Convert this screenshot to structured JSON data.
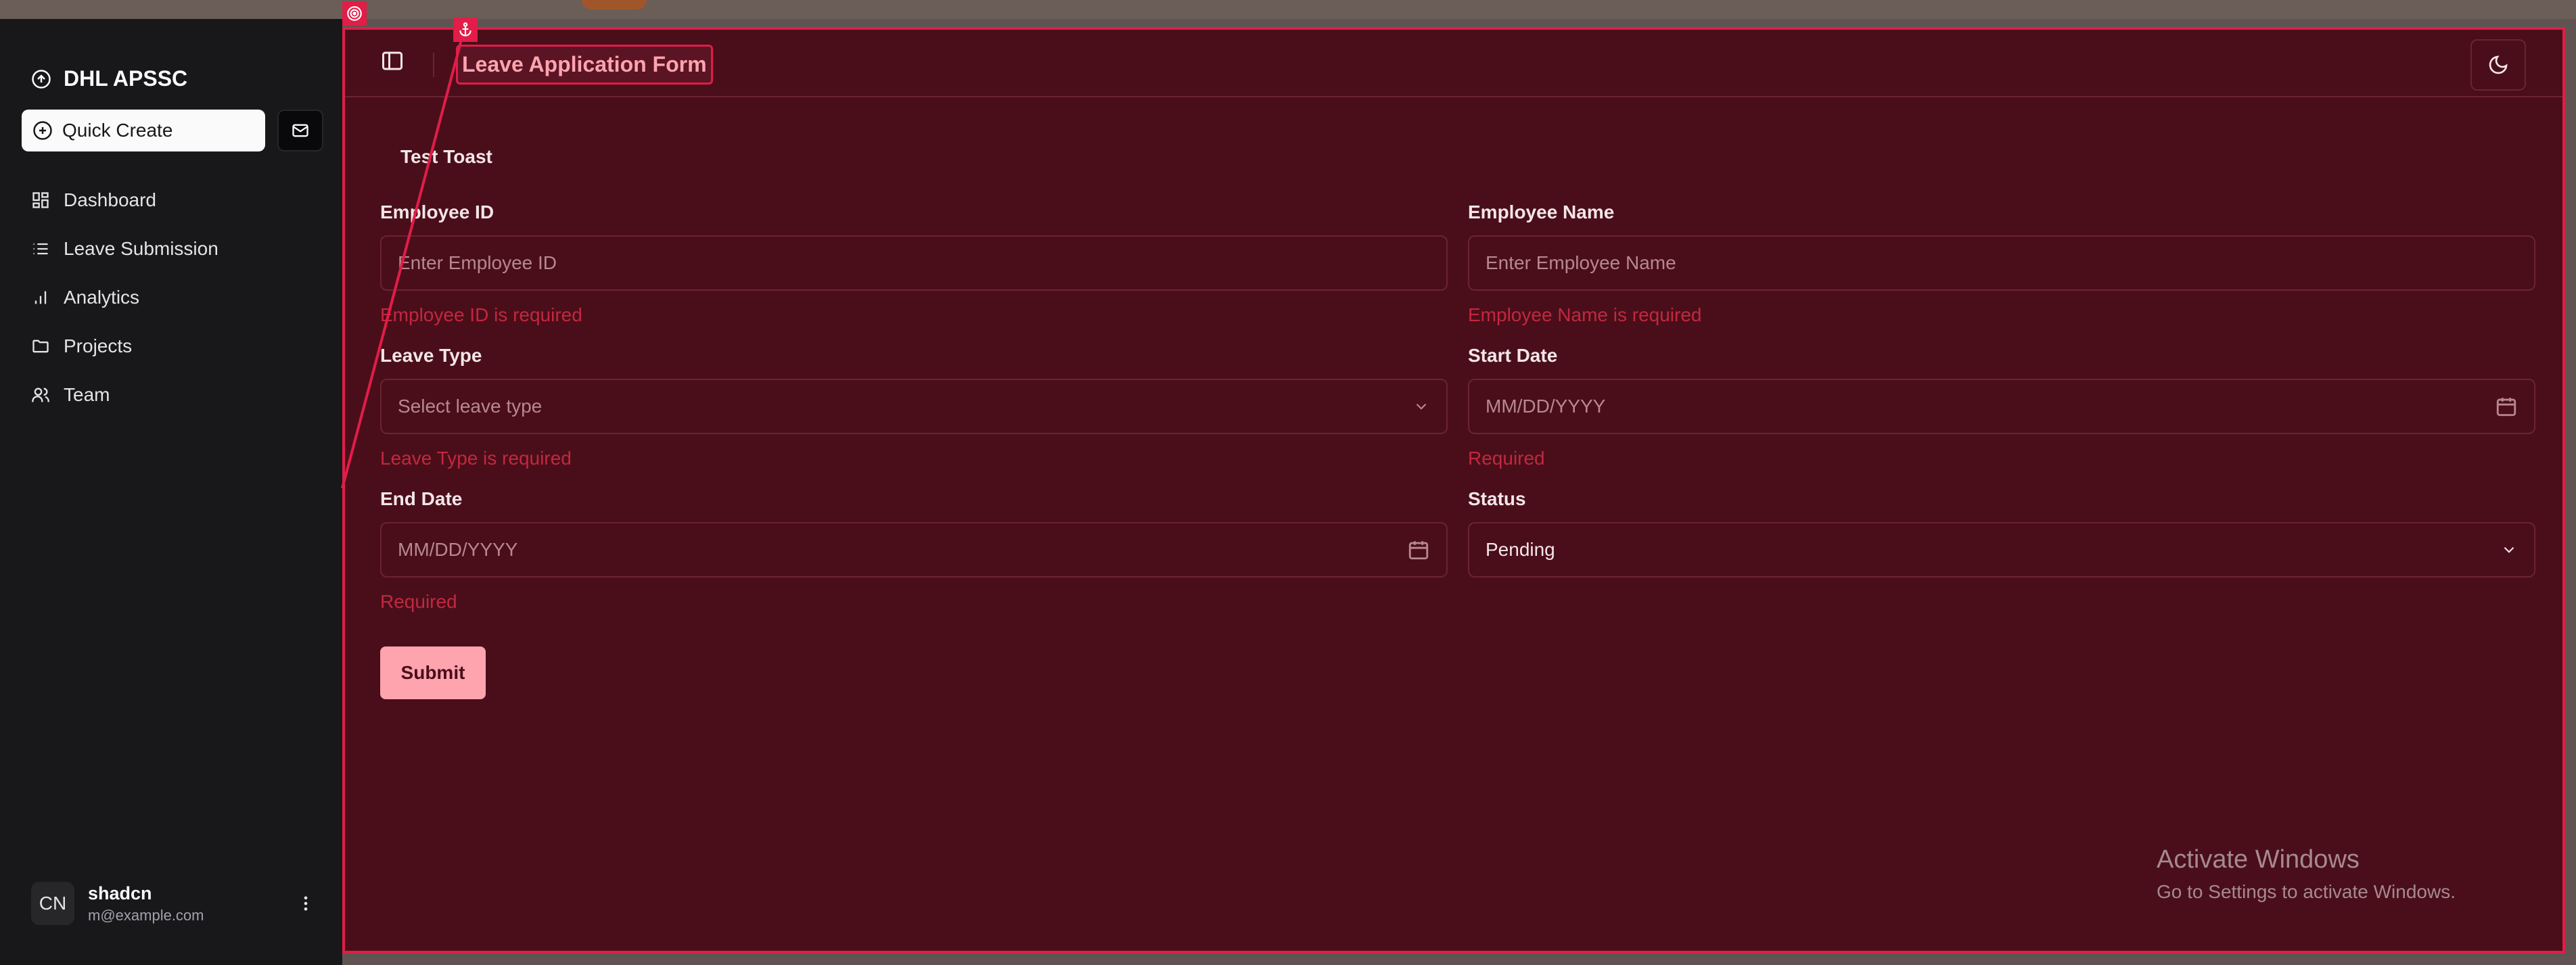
{
  "brand": {
    "name": "DHL APSSC",
    "icon": "circle-arrow-up-icon"
  },
  "quick_create": {
    "label": "Quick Create",
    "icon": "plus-circle-icon",
    "mail_icon": "mail-icon"
  },
  "nav": [
    {
      "label": "Dashboard",
      "icon": "dashboard-icon"
    },
    {
      "label": "Leave Submission",
      "icon": "list-icon"
    },
    {
      "label": "Analytics",
      "icon": "bar-chart-icon"
    },
    {
      "label": "Projects",
      "icon": "folder-icon"
    },
    {
      "label": "Team",
      "icon": "users-icon"
    }
  ],
  "user": {
    "initials": "CN",
    "name": "shadcn",
    "email": "m@example.com"
  },
  "header": {
    "title": "Leave Application Form"
  },
  "toast_button": "Test Toast",
  "form": {
    "employee_id": {
      "label": "Employee ID",
      "placeholder": "Enter Employee ID",
      "error": "Employee ID is required"
    },
    "employee_name": {
      "label": "Employee Name",
      "placeholder": "Enter Employee Name",
      "error": "Employee Name is required"
    },
    "leave_type": {
      "label": "Leave Type",
      "placeholder": "Select leave type",
      "error": "Leave Type is required"
    },
    "start_date": {
      "label": "Start Date",
      "placeholder": "MM/DD/YYYY",
      "error": "Required"
    },
    "end_date": {
      "label": "End Date",
      "placeholder": "MM/DD/YYYY",
      "error": "Required"
    },
    "status": {
      "label": "Status",
      "value": "Pending"
    }
  },
  "submit_label": "Submit",
  "watermark": {
    "line1": "Activate Windows",
    "line2": "Go to Settings to activate Windows."
  },
  "colors": {
    "accent": "#e11d48",
    "error": "#c2283f",
    "main_bg": "#4a0e1a",
    "sidebar_bg": "#18181b"
  }
}
